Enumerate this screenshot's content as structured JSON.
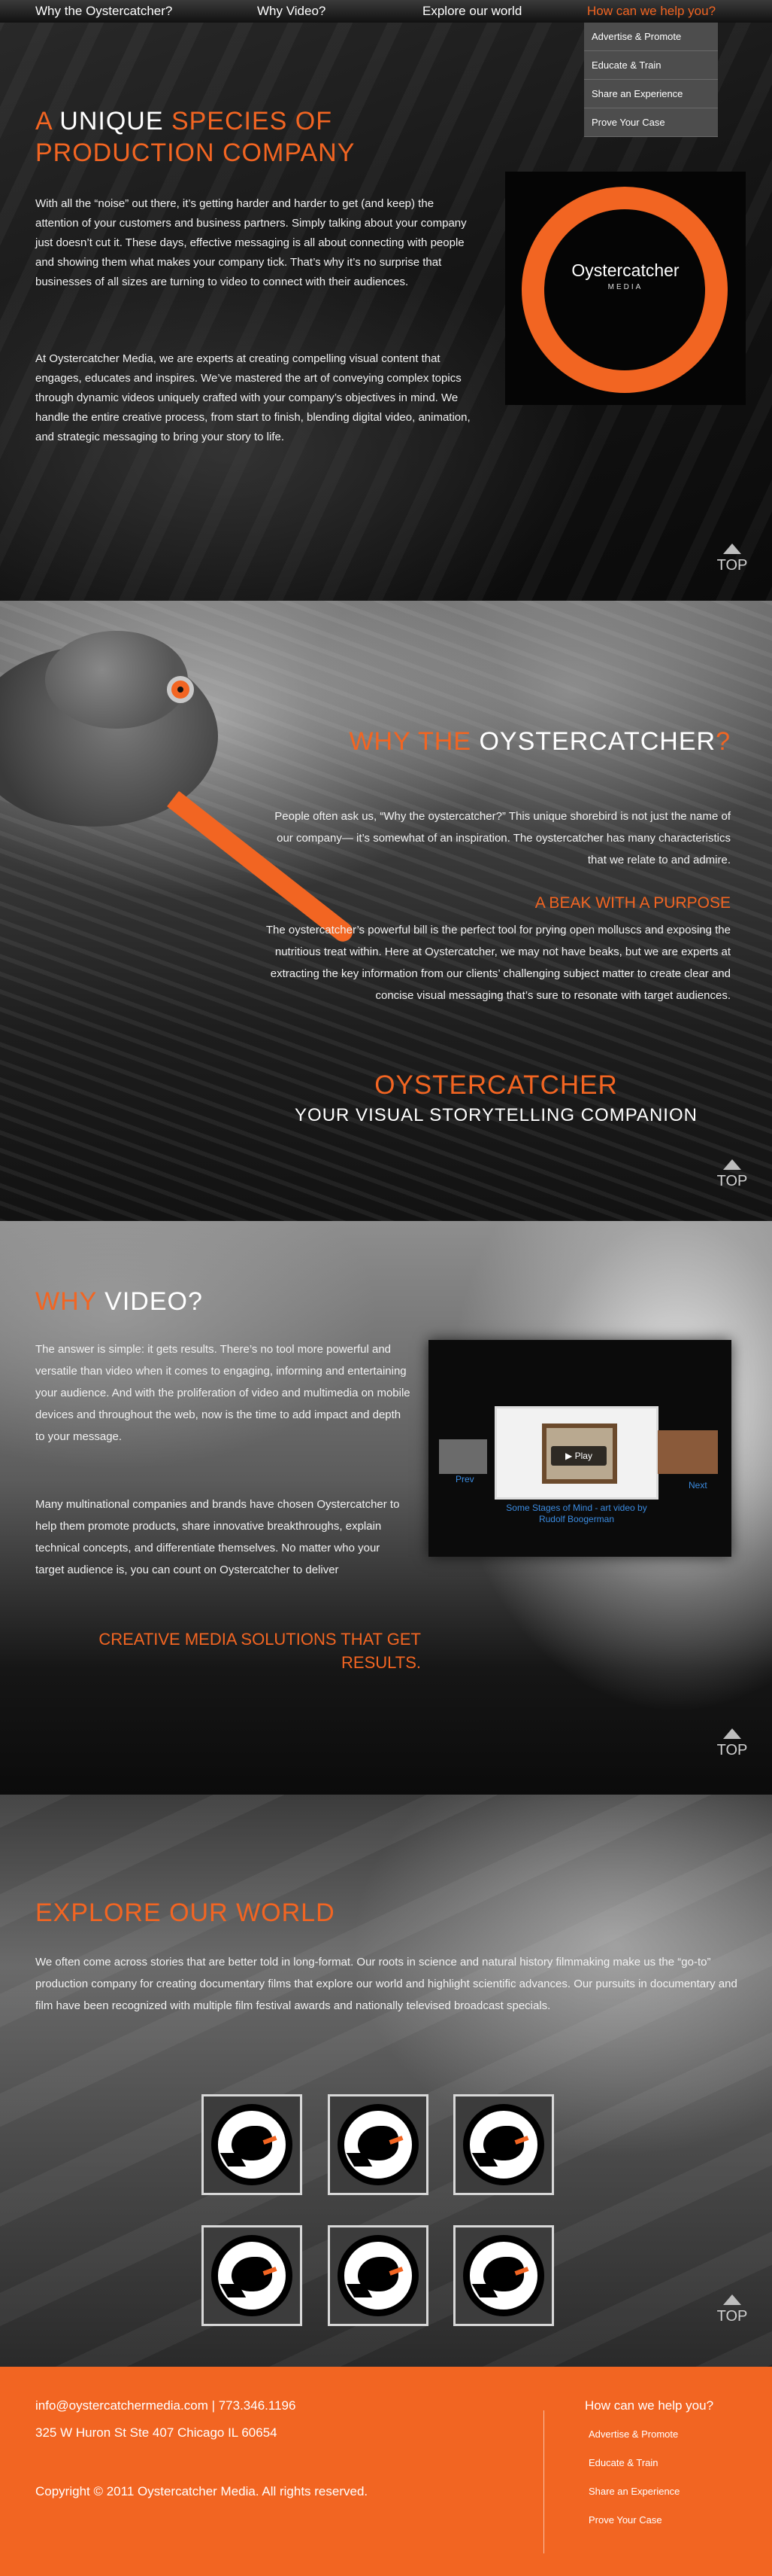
{
  "nav": {
    "items": [
      "Why the Oystercatcher?",
      "Why Video?",
      "Explore our world",
      "How can we help you?"
    ],
    "dropdown": [
      "Advertise & Promote",
      "Educate & Train",
      "Share an Experience",
      "Prove Your Case"
    ]
  },
  "hero": {
    "heading_a": "A",
    "heading_b": "UNIQUE",
    "heading_c": "SPECIES OF",
    "heading_d": "PRODUCTION COMPANY",
    "paragraphs": [
      "With all the “noise” out there, it’s getting harder and harder to get (and keep) the attention of your customers and business partners. Simply talking about your company just doesn’t cut it. These days, effective messaging is all about connecting with people and showing them what makes your company tick. That’s why it’s no surprise that businesses of all sizes are turning to video to connect with their audiences.",
      "At Oystercatcher Media, we are experts at creating compelling visual content that engages, educates and inspires. We’ve mastered the art of conveying complex topics through dynamic videos uniquely crafted with your company’s objectives in mind. We handle the entire creative process, from start to finish, blending digital video, animation, and strategic messaging to bring your story to life."
    ],
    "logo_name": "Oystercatcher",
    "logo_sub": "MEDIA"
  },
  "why_oyster": {
    "heading_a": "WHY THE",
    "heading_b": "OYSTERCATCHER",
    "heading_c": "?",
    "intro": "People often ask us, “Why the oystercatcher?” This unique shorebird is not just the name of our company— it’s somewhat of an inspiration. The oystercatcher has many characteristics that we relate to and admire.",
    "subheading": "A BEAK WITH A PURPOSE",
    "body": "The oystercatcher’s powerful bill is the perfect tool for prying open molluscs and exposing the nutritious treat within. Here at Oystercatcher, we may not have beaks, but we are experts at extracting the key information from our clients’ challenging subject matter to create clear and concise visual messaging that’s sure to resonate with target audiences.",
    "tag1": "OYSTERCATCHER",
    "tag2": "YOUR VISUAL STORYTELLING COMPANION"
  },
  "why_video": {
    "heading_a": "WHY",
    "heading_b": "VIDEO?",
    "p1": "The answer is simple: it gets results. There’s no tool more powerful and versatile than video when it comes to engaging, informing and entertaining your audience. And with the proliferation of video and multimedia on mobile devices and throughout the web, now is the time to add impact and depth to your message.",
    "p2": "Many multinational companies and brands have chosen Oystercatcher to help them promote products, share innovative breakthroughs, explain technical concepts, and differentiate themselves. No matter who your target audience is, you can count on Oystercatcher to deliver",
    "cta": "CREATIVE MEDIA SOLUTIONS THAT GET RESULTS.",
    "player": {
      "prev": "Prev",
      "next": "Next",
      "play": "▶ Play",
      "caption": "Some Stages of Mind - art video by Rudolf Boogerman"
    }
  },
  "explore": {
    "heading": "EXPLORE OUR WORLD",
    "body": "We often come across stories that are better told in long-format. Our roots in science and natural history filmmaking make us the “go-to” production company for creating documentary films that explore our world and highlight scientific advances. Our pursuits in documentary and film have been recognized with multiple film festival awards and nationally televised broadcast specials."
  },
  "top_label": "TOP",
  "footer": {
    "contact": "info@oystercatchermedia.com | 773.346.1196",
    "address": "325 W Huron St Ste 407 Chicago IL 60654",
    "copyright": "Copyright © 2011 Oystercatcher Media. All rights reserved.",
    "help_heading": "How can we help you?",
    "links": [
      "Advertise & Promote",
      "Educate & Train",
      "Share an Experience",
      "Prove Your Case"
    ]
  },
  "colors": {
    "accent": "#f26522",
    "link": "#3b8be0"
  }
}
